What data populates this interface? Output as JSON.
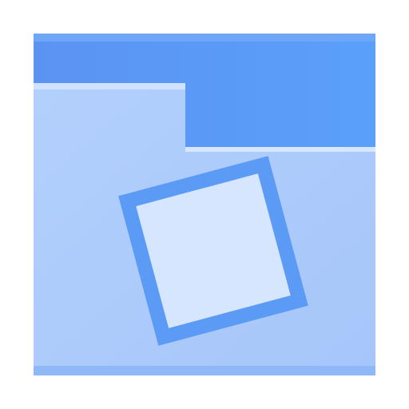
{
  "icon": {
    "name": "folder-image-icon",
    "colors": {
      "background": "#ffffff",
      "folder_back_top": "#5B9AF5",
      "folder_back_right": "#5A99F6",
      "folder_front": "#A9C8FB",
      "folder_front_light": "#B6D1FC",
      "front_edge_highlight": "#D7E6FE",
      "bottom_strip": "#8FB8F8",
      "photo_frame": "#5B9AF5",
      "photo_inner": "#D6E6FE"
    }
  }
}
